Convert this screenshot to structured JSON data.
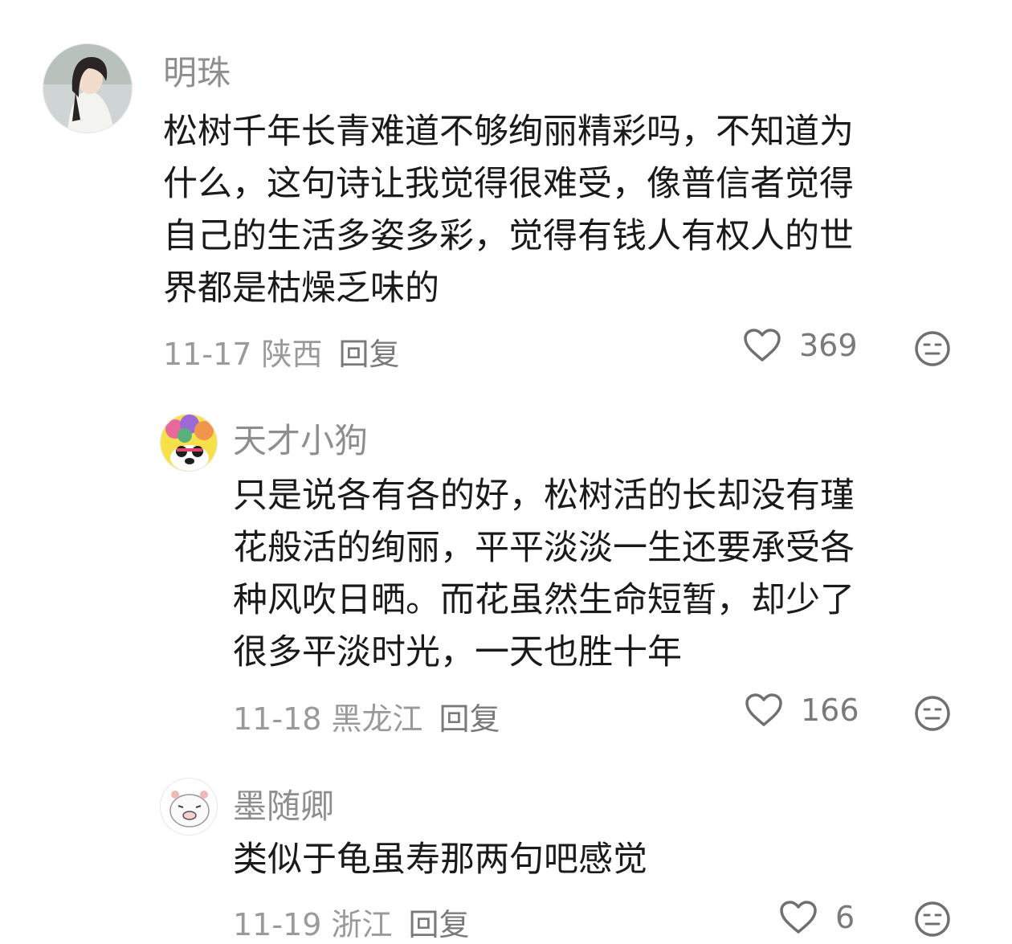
{
  "comments": [
    {
      "username": "明珠",
      "lines": [
        "松树千年长青难道不够绚丽精彩吗，不知道为",
        "什么，这句诗让我觉得很难受，像普信者觉得",
        "自己的生活多姿多彩，觉得有钱人有权人的世",
        "界都是枯燥乏味的"
      ],
      "date_location": "11-17 陕西",
      "reply_label": "回复",
      "likes": "369",
      "like_icon": "heart-outline-icon",
      "dislike_icon": "meh-face-icon"
    },
    {
      "username": "天才小狗",
      "lines": [
        "只是说各有各的好，松树活的长却没有瑾",
        "花般活的绚丽，平平淡淡一生还要承受各",
        "种风吹日晒。而花虽然生命短暂，却少了",
        "很多平淡时光，一天也胜十年"
      ],
      "date_location": "11-18 黑龙江",
      "reply_label": "回复",
      "likes": "166",
      "like_icon": "heart-outline-icon",
      "dislike_icon": "meh-face-icon"
    },
    {
      "username": "墨随卿",
      "lines": [
        "类似于龟虽寿那两句吧感觉"
      ],
      "date_location": "11-19 浙江",
      "reply_label": "回复",
      "likes": "6",
      "like_icon": "heart-outline-icon",
      "dislike_icon": "meh-face-icon"
    }
  ],
  "colors": {
    "text": "#1a1a1a",
    "username": "#8e8e8e",
    "meta": "#9a9a9a",
    "icon": "#707070"
  }
}
